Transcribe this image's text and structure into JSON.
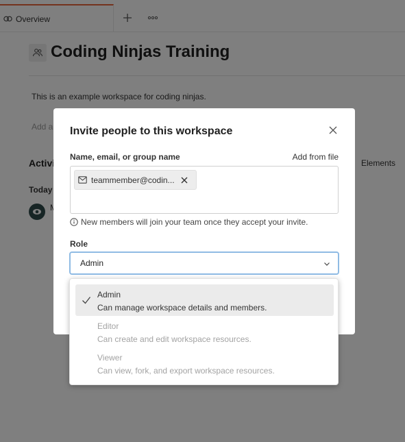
{
  "tabs": {
    "overview_label": "Overview"
  },
  "workspace": {
    "title": "Coding Ninjas Training",
    "description": "This is an example workspace for coding ninjas.",
    "add_hint": "Add a",
    "activity_heading": "Activi",
    "elements_label": "Elements",
    "today_label": "Today",
    "activity_initial": "M"
  },
  "modal": {
    "title": "Invite people to this workspace",
    "field_label": "Name, email, or group name",
    "add_from_file": "Add from file",
    "chip_text": "teammember@codin...",
    "note": "New members will join your team once they accept your invite.",
    "role_label": "Role",
    "role_value": "Admin"
  },
  "dropdown": {
    "options": [
      {
        "name": "Admin",
        "desc": "Can manage workspace details and members.",
        "selected": true
      },
      {
        "name": "Editor",
        "desc": "Can create and edit workspace resources."
      },
      {
        "name": "Viewer",
        "desc": "Can view, fork, and export workspace resources."
      }
    ]
  },
  "colors": {
    "accent_tab": "#e8643a",
    "focus_border": "#8fbbe4",
    "overlay": "rgba(0,0,0,0.5)"
  },
  "icons": [
    "overview-icon",
    "plus-icon",
    "more-icon",
    "workspace-icon",
    "avatar-icon",
    "close-icon",
    "mail-icon",
    "remove-chip-icon",
    "info-icon",
    "chevron-down-icon",
    "check-icon"
  ]
}
